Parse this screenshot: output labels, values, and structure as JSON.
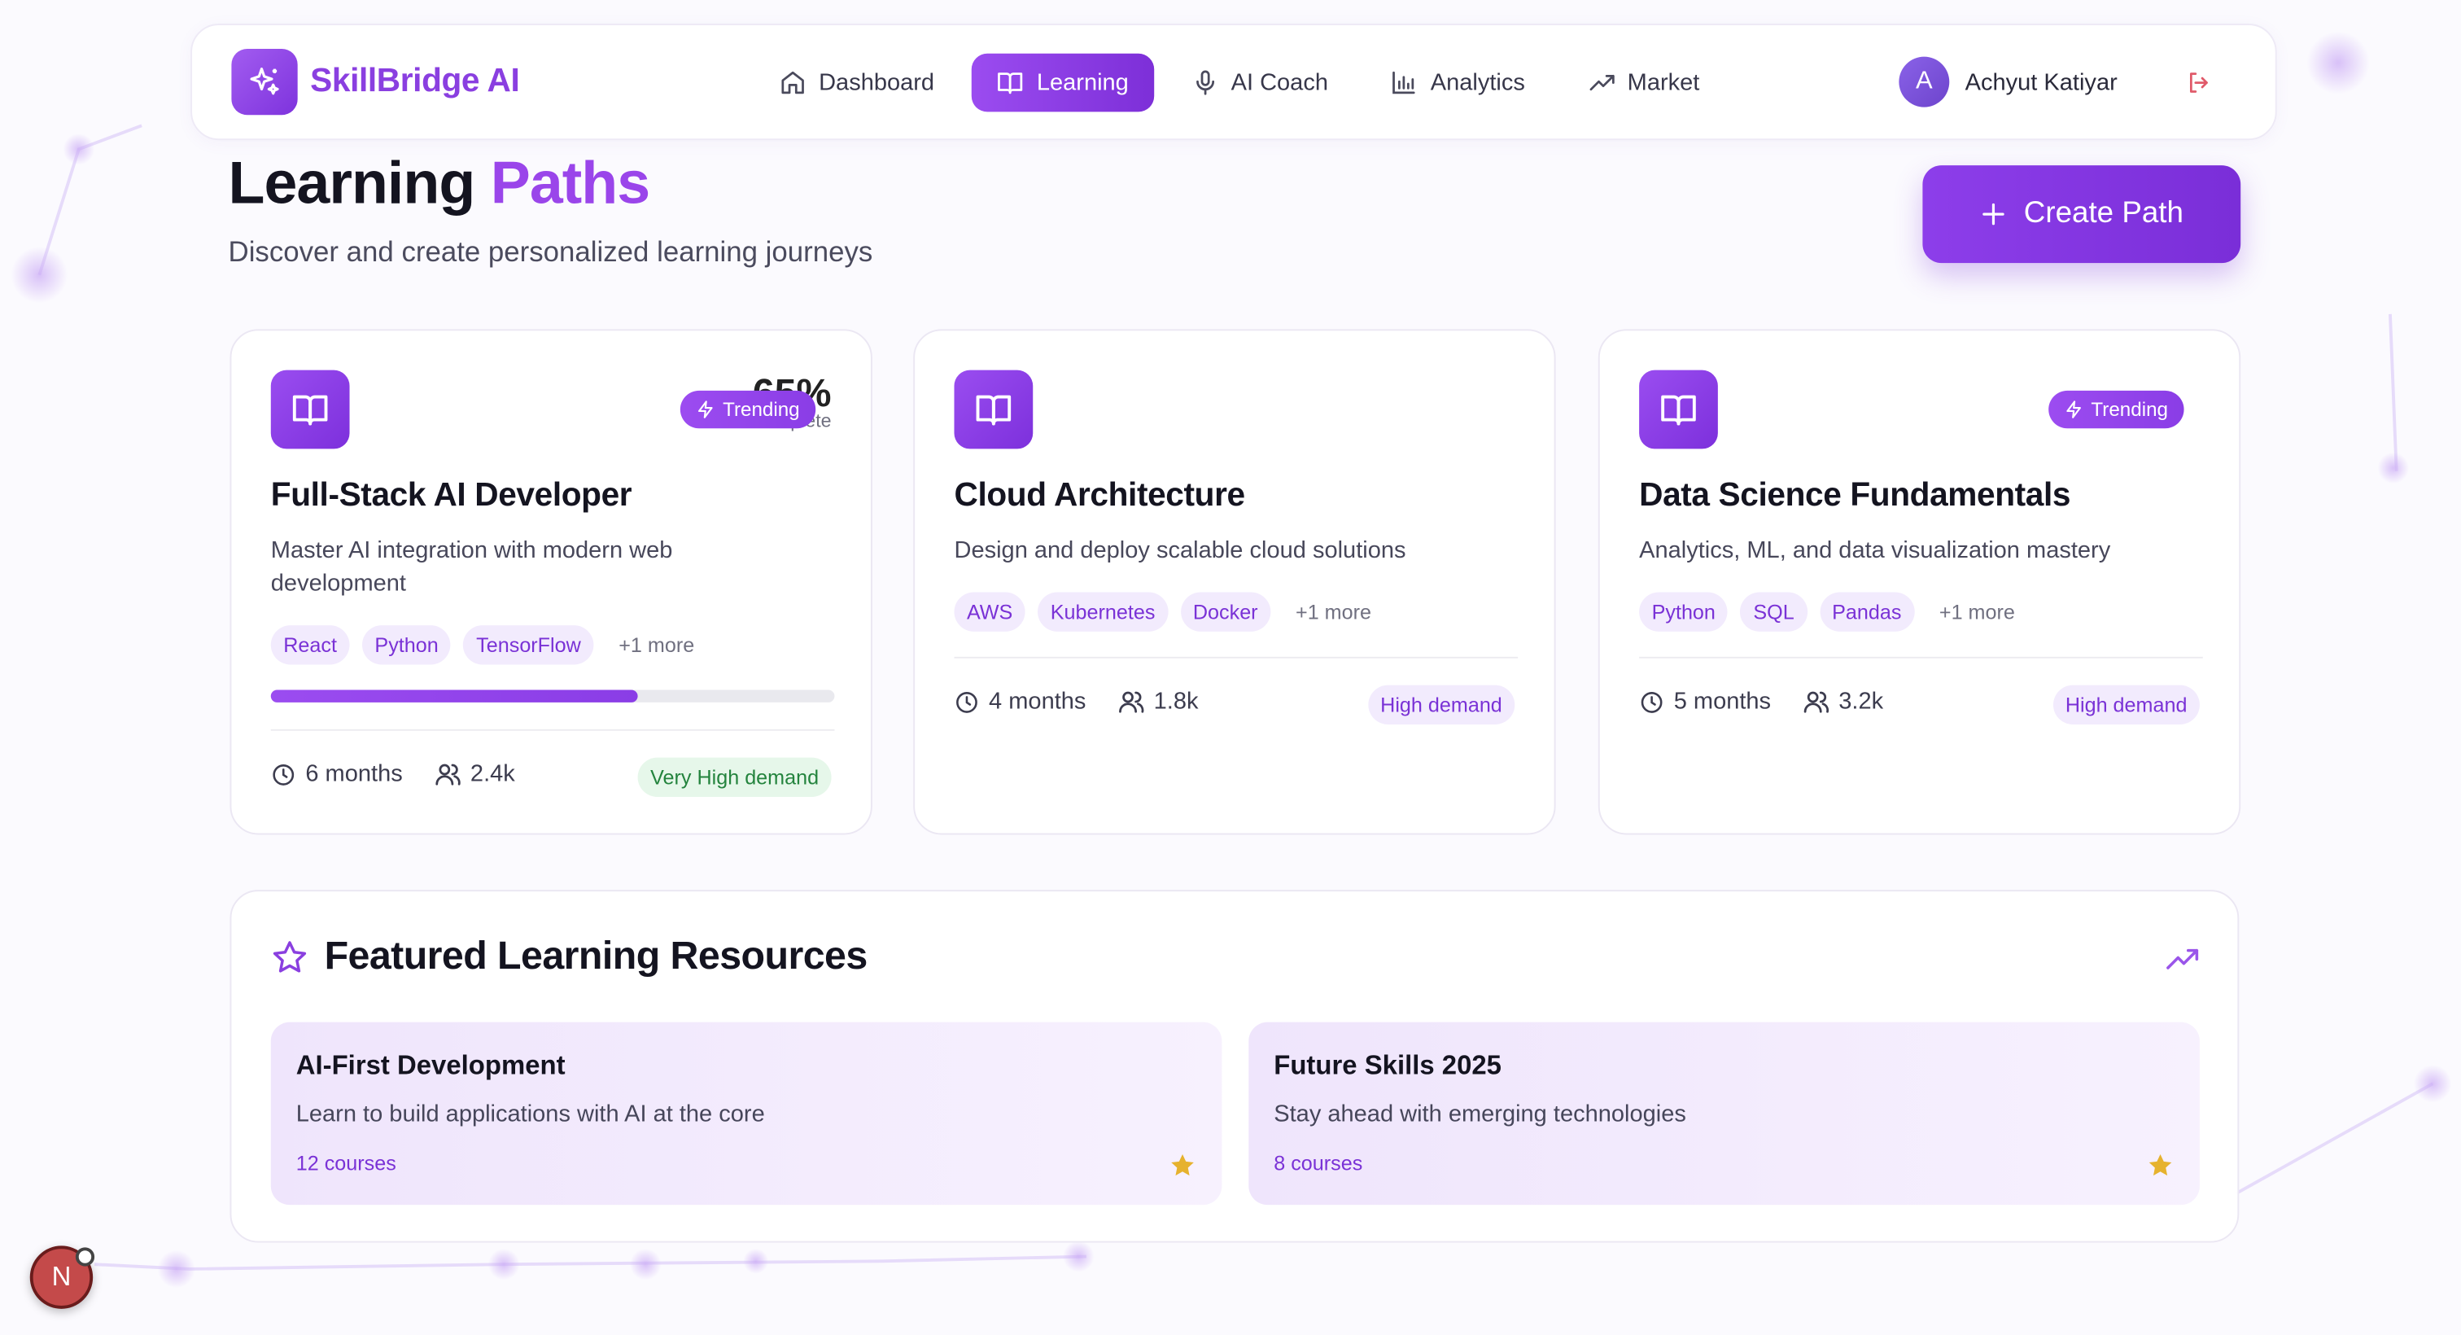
{
  "brand": {
    "name": "SkillBridge AI"
  },
  "nav": {
    "items": [
      {
        "label": "Dashboard",
        "icon": "home-icon",
        "active": false
      },
      {
        "label": "Learning",
        "icon": "book-icon",
        "active": true
      },
      {
        "label": "AI Coach",
        "icon": "mic-icon",
        "active": false
      },
      {
        "label": "Analytics",
        "icon": "bar-chart-icon",
        "active": false
      },
      {
        "label": "Market",
        "icon": "trending-up-icon",
        "active": false
      }
    ]
  },
  "user": {
    "initial": "A",
    "name": "Achyut Katiyar"
  },
  "page": {
    "title_main": "Learning",
    "title_accent": "Paths",
    "subtitle": "Discover and create personalized learning journeys",
    "create_label": "Create Path"
  },
  "paths": [
    {
      "title": "Full-Stack AI Developer",
      "description": "Master AI integration with modern web development",
      "tags": [
        "React",
        "Python",
        "TensorFlow"
      ],
      "more": "+1 more",
      "progress_value": "65%",
      "progress_label": "Complete",
      "progress_fraction": 0.65,
      "trending_label": "Trending",
      "duration": "6 months",
      "learners": "2.4k",
      "demand": "Very High demand"
    },
    {
      "title": "Cloud Architecture",
      "description": "Design and deploy scalable cloud solutions",
      "tags": [
        "AWS",
        "Kubernetes",
        "Docker"
      ],
      "more": "+1 more",
      "duration": "4 months",
      "learners": "1.8k",
      "demand": "High demand"
    },
    {
      "title": "Data Science Fundamentals",
      "description": "Analytics, ML, and data visualization mastery",
      "tags": [
        "Python",
        "SQL",
        "Pandas"
      ],
      "more": "+1 more",
      "trending_label": "Trending",
      "duration": "5 months",
      "learners": "3.2k",
      "demand": "High demand"
    }
  ],
  "featured": {
    "title": "Featured Learning Resources",
    "resources": [
      {
        "title": "AI-First Development",
        "description": "Learn to build applications with AI at the core",
        "courses": "12 courses"
      },
      {
        "title": "Future Skills 2025",
        "description": "Stay ahead with emerging technologies",
        "courses": "8 courses"
      }
    ]
  },
  "dev_badge": {
    "letter": "N"
  },
  "colors": {
    "accent": "#8a3fe0",
    "accent_light": "#f2ebfd",
    "success_bg": "#e6f7ea",
    "success_text": "#24843e",
    "star": "#e6b22e"
  }
}
